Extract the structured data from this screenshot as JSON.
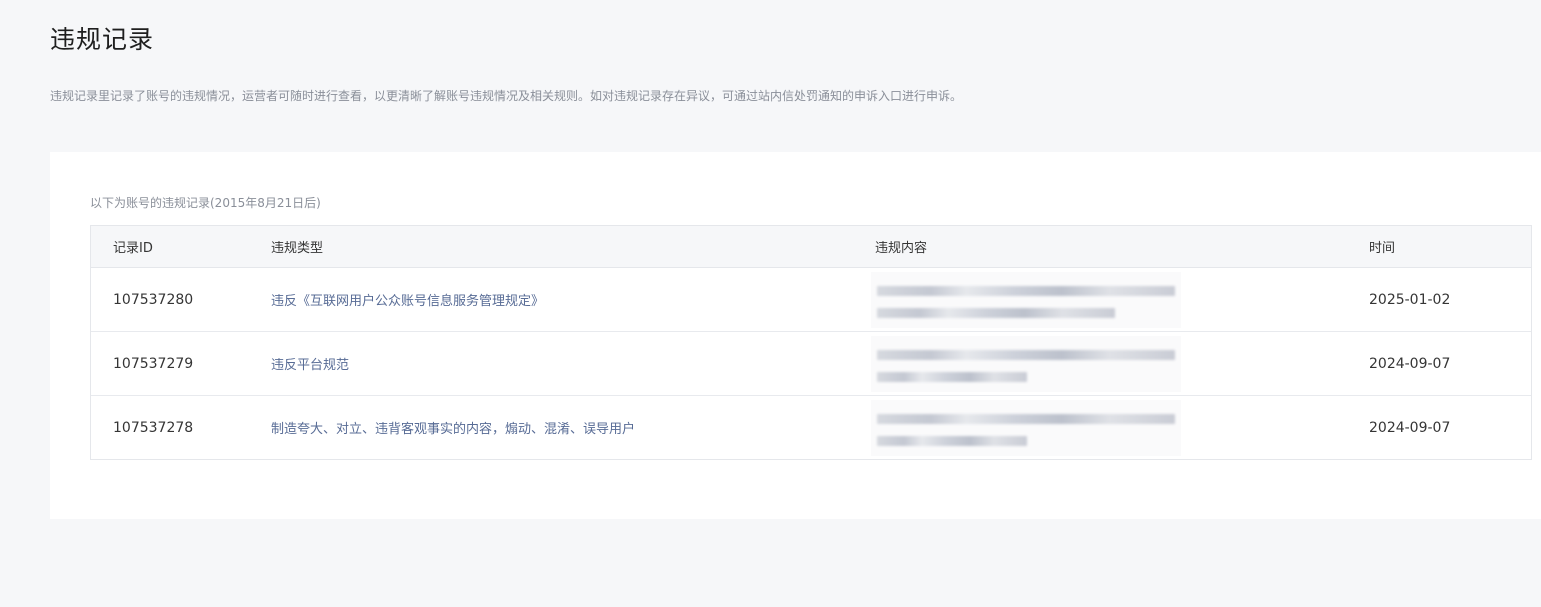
{
  "page": {
    "title": "违规记录",
    "description": "违规记录里记录了账号的违规情况，运营者可随时进行查看，以更清晰了解账号违规情况及相关规则。如对违规记录存在异议，可通过站内信处罚通知的申诉入口进行申诉。"
  },
  "records": {
    "caption": "以下为账号的违规记录(2015年8月21日后)",
    "columns": {
      "id": "记录ID",
      "type": "违规类型",
      "content": "违规内容",
      "time": "时间"
    },
    "rows": [
      {
        "id": "107537280",
        "type": "违反《互联网用户公众账号信息服务管理规定》",
        "time": "2025-01-02"
      },
      {
        "id": "107537279",
        "type": "违反平台规范",
        "time": "2024-09-07"
      },
      {
        "id": "107537278",
        "type": "制造夸大、对立、违背客观事实的内容，煽动、混淆、误导用户",
        "time": "2024-09-07"
      }
    ]
  },
  "colors": {
    "link": "#576b95",
    "page_background": "#f6f7f9",
    "card_background": "#ffffff"
  }
}
